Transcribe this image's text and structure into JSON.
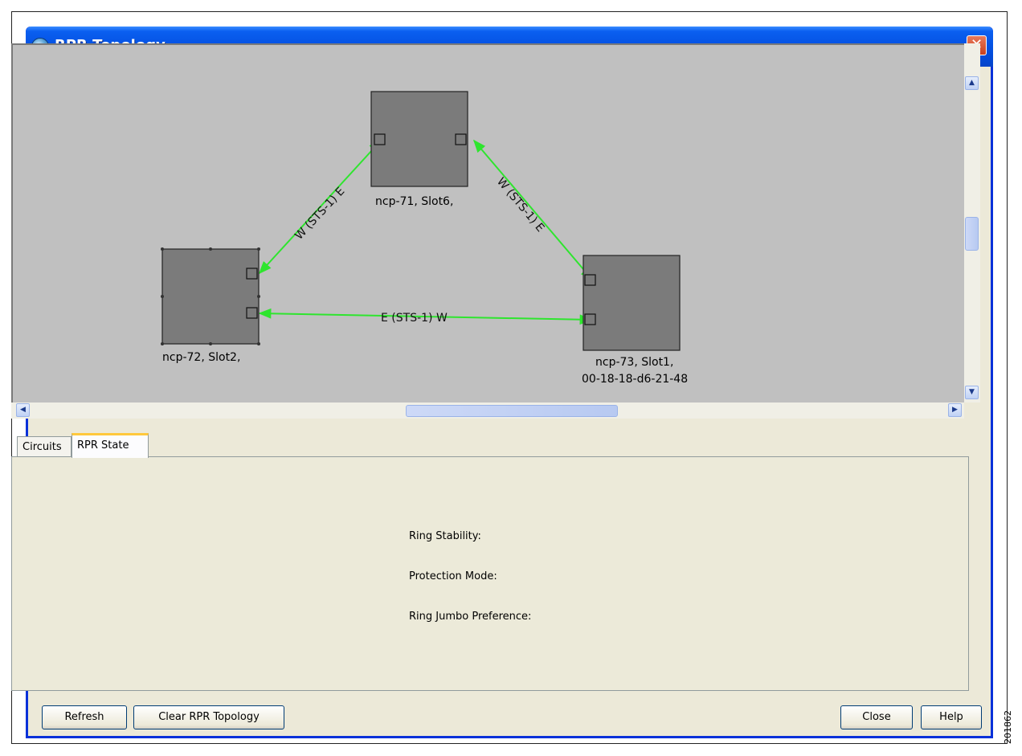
{
  "window": {
    "title": "RPR Topology",
    "close_glyph": "✕",
    "icon": "network-globe-icon"
  },
  "topology": {
    "nodes": [
      {
        "id": "n71",
        "label_lines": [
          "ncp-71, Slot6,"
        ]
      },
      {
        "id": "n72",
        "label_lines": [
          "ncp-72, Slot2,"
        ]
      },
      {
        "id": "n73",
        "label_lines": [
          "ncp-73, Slot1,",
          "00-18-18-d6-21-48"
        ]
      }
    ],
    "links": [
      {
        "from": "n72",
        "to": "n71",
        "label": "W (STS-1) E"
      },
      {
        "from": "n71",
        "to": "n73",
        "label": "W (STS-1) E"
      },
      {
        "from": "n72",
        "to": "n73",
        "label": "E (STS-1) W"
      }
    ],
    "link_color": "#2ee52e",
    "background": "#c0c0c0"
  },
  "tabs": [
    {
      "label": "Circuits",
      "active": false
    },
    {
      "label": "RPR State",
      "active": true
    }
  ],
  "rpr_state": {
    "ring_stability_label": "Ring Stability:",
    "protection_mode_label": "Protection Mode:",
    "ring_jumbo_label": "Ring Jumbo Preference:"
  },
  "buttons": {
    "refresh": "Refresh",
    "clear": "Clear RPR Topology",
    "close": "Close",
    "help": "Help"
  },
  "side_id": "201862"
}
